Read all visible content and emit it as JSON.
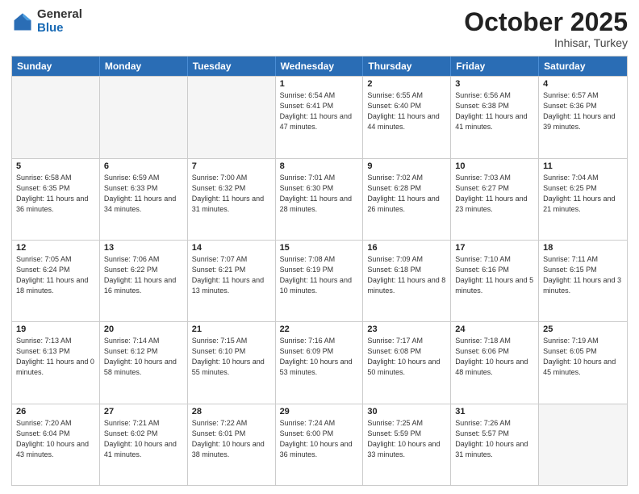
{
  "header": {
    "logo_general": "General",
    "logo_blue": "Blue",
    "month": "October 2025",
    "location": "Inhisar, Turkey"
  },
  "days_of_week": [
    "Sunday",
    "Monday",
    "Tuesday",
    "Wednesday",
    "Thursday",
    "Friday",
    "Saturday"
  ],
  "weeks": [
    [
      {
        "day": "",
        "info": "",
        "empty": true
      },
      {
        "day": "",
        "info": "",
        "empty": true
      },
      {
        "day": "",
        "info": "",
        "empty": true
      },
      {
        "day": "1",
        "info": "Sunrise: 6:54 AM\nSunset: 6:41 PM\nDaylight: 11 hours\nand 47 minutes."
      },
      {
        "day": "2",
        "info": "Sunrise: 6:55 AM\nSunset: 6:40 PM\nDaylight: 11 hours\nand 44 minutes."
      },
      {
        "day": "3",
        "info": "Sunrise: 6:56 AM\nSunset: 6:38 PM\nDaylight: 11 hours\nand 41 minutes."
      },
      {
        "day": "4",
        "info": "Sunrise: 6:57 AM\nSunset: 6:36 PM\nDaylight: 11 hours\nand 39 minutes."
      }
    ],
    [
      {
        "day": "5",
        "info": "Sunrise: 6:58 AM\nSunset: 6:35 PM\nDaylight: 11 hours\nand 36 minutes."
      },
      {
        "day": "6",
        "info": "Sunrise: 6:59 AM\nSunset: 6:33 PM\nDaylight: 11 hours\nand 34 minutes."
      },
      {
        "day": "7",
        "info": "Sunrise: 7:00 AM\nSunset: 6:32 PM\nDaylight: 11 hours\nand 31 minutes."
      },
      {
        "day": "8",
        "info": "Sunrise: 7:01 AM\nSunset: 6:30 PM\nDaylight: 11 hours\nand 28 minutes."
      },
      {
        "day": "9",
        "info": "Sunrise: 7:02 AM\nSunset: 6:28 PM\nDaylight: 11 hours\nand 26 minutes."
      },
      {
        "day": "10",
        "info": "Sunrise: 7:03 AM\nSunset: 6:27 PM\nDaylight: 11 hours\nand 23 minutes."
      },
      {
        "day": "11",
        "info": "Sunrise: 7:04 AM\nSunset: 6:25 PM\nDaylight: 11 hours\nand 21 minutes."
      }
    ],
    [
      {
        "day": "12",
        "info": "Sunrise: 7:05 AM\nSunset: 6:24 PM\nDaylight: 11 hours\nand 18 minutes."
      },
      {
        "day": "13",
        "info": "Sunrise: 7:06 AM\nSunset: 6:22 PM\nDaylight: 11 hours\nand 16 minutes."
      },
      {
        "day": "14",
        "info": "Sunrise: 7:07 AM\nSunset: 6:21 PM\nDaylight: 11 hours\nand 13 minutes."
      },
      {
        "day": "15",
        "info": "Sunrise: 7:08 AM\nSunset: 6:19 PM\nDaylight: 11 hours\nand 10 minutes."
      },
      {
        "day": "16",
        "info": "Sunrise: 7:09 AM\nSunset: 6:18 PM\nDaylight: 11 hours\nand 8 minutes."
      },
      {
        "day": "17",
        "info": "Sunrise: 7:10 AM\nSunset: 6:16 PM\nDaylight: 11 hours\nand 5 minutes."
      },
      {
        "day": "18",
        "info": "Sunrise: 7:11 AM\nSunset: 6:15 PM\nDaylight: 11 hours\nand 3 minutes."
      }
    ],
    [
      {
        "day": "19",
        "info": "Sunrise: 7:13 AM\nSunset: 6:13 PM\nDaylight: 11 hours\nand 0 minutes."
      },
      {
        "day": "20",
        "info": "Sunrise: 7:14 AM\nSunset: 6:12 PM\nDaylight: 10 hours\nand 58 minutes."
      },
      {
        "day": "21",
        "info": "Sunrise: 7:15 AM\nSunset: 6:10 PM\nDaylight: 10 hours\nand 55 minutes."
      },
      {
        "day": "22",
        "info": "Sunrise: 7:16 AM\nSunset: 6:09 PM\nDaylight: 10 hours\nand 53 minutes."
      },
      {
        "day": "23",
        "info": "Sunrise: 7:17 AM\nSunset: 6:08 PM\nDaylight: 10 hours\nand 50 minutes."
      },
      {
        "day": "24",
        "info": "Sunrise: 7:18 AM\nSunset: 6:06 PM\nDaylight: 10 hours\nand 48 minutes."
      },
      {
        "day": "25",
        "info": "Sunrise: 7:19 AM\nSunset: 6:05 PM\nDaylight: 10 hours\nand 45 minutes."
      }
    ],
    [
      {
        "day": "26",
        "info": "Sunrise: 7:20 AM\nSunset: 6:04 PM\nDaylight: 10 hours\nand 43 minutes."
      },
      {
        "day": "27",
        "info": "Sunrise: 7:21 AM\nSunset: 6:02 PM\nDaylight: 10 hours\nand 41 minutes."
      },
      {
        "day": "28",
        "info": "Sunrise: 7:22 AM\nSunset: 6:01 PM\nDaylight: 10 hours\nand 38 minutes."
      },
      {
        "day": "29",
        "info": "Sunrise: 7:24 AM\nSunset: 6:00 PM\nDaylight: 10 hours\nand 36 minutes."
      },
      {
        "day": "30",
        "info": "Sunrise: 7:25 AM\nSunset: 5:59 PM\nDaylight: 10 hours\nand 33 minutes."
      },
      {
        "day": "31",
        "info": "Sunrise: 7:26 AM\nSunset: 5:57 PM\nDaylight: 10 hours\nand 31 minutes."
      },
      {
        "day": "",
        "info": "",
        "empty": true
      }
    ]
  ]
}
